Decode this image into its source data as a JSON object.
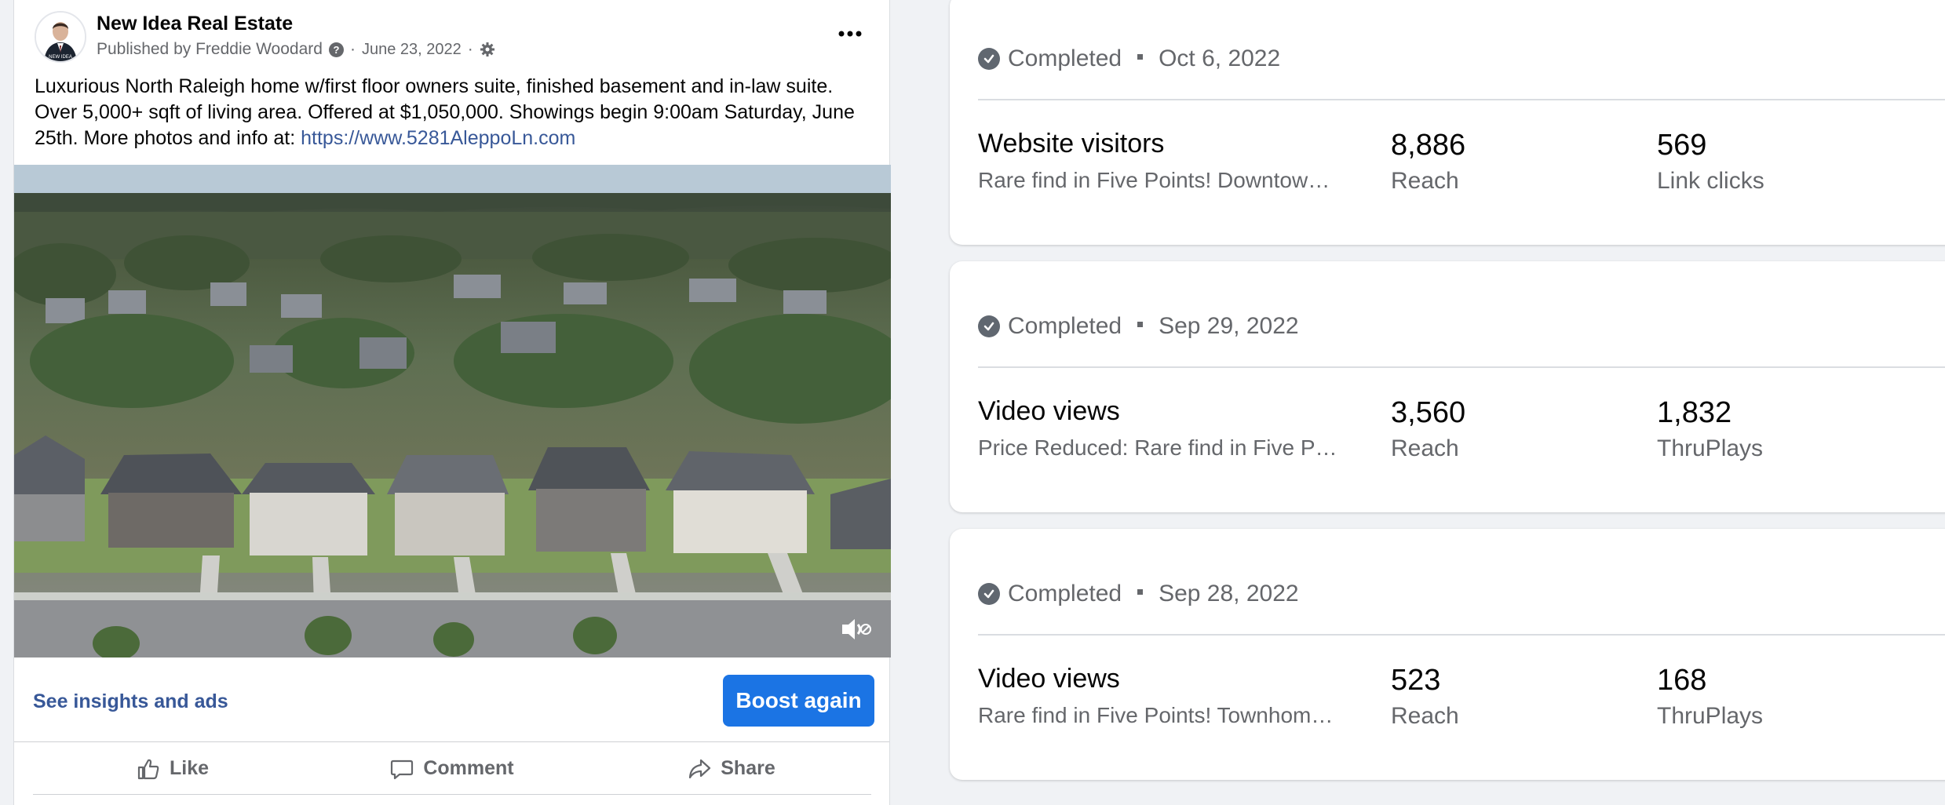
{
  "post": {
    "page_name": "New Idea Real Estate",
    "published_by": "Published by Freddie Woodard",
    "date": "June 23, 2022",
    "separator": "·",
    "help_glyph": "?",
    "body_text": "Luxurious North Raleigh home w/first floor owners suite, finished basement and in-law suite. Over 5,000+ sqft of living area. Offered at $1,050,000. Showings begin 9:00am Saturday, June 25th. More photos and info at: ",
    "link_text": "https://www.5281AleppoLn.com",
    "avatar_text": "NEW IDEA",
    "insights_link": "See insights and ads",
    "boost_button": "Boost again",
    "actions": {
      "like": "Like",
      "comment": "Comment",
      "share": "Share"
    },
    "link_color": "#385898",
    "boost_color": "#1b74e4"
  },
  "campaigns": [
    {
      "status": "Completed",
      "date": "Oct 6, 2022",
      "objective": "Website visitors",
      "ad_name": "Rare find in Five Points! Downtown…",
      "metric1_value": "8,886",
      "metric1_label": "Reach",
      "metric2_value": "569",
      "metric2_label": "Link clicks"
    },
    {
      "status": "Completed",
      "date": "Sep 29, 2022",
      "objective": "Video views",
      "ad_name": "Price Reduced: Rare find in Five Po…",
      "metric1_value": "3,560",
      "metric1_label": "Reach",
      "metric2_value": "1,832",
      "metric2_label": "ThruPlays"
    },
    {
      "status": "Completed",
      "date": "Sep 28, 2022",
      "objective": "Video views",
      "ad_name": "Rare find in Five Points! Townhome…",
      "metric1_value": "523",
      "metric1_label": "Reach",
      "metric2_value": "168",
      "metric2_label": "ThruPlays"
    }
  ],
  "icons": {
    "more": "more-options-icon",
    "gear": "gear-icon",
    "check": "check-circle-icon",
    "mute": "mute-icon",
    "like": "thumbs-up-icon",
    "comment": "comment-bubble-icon",
    "share": "share-arrow-icon"
  }
}
